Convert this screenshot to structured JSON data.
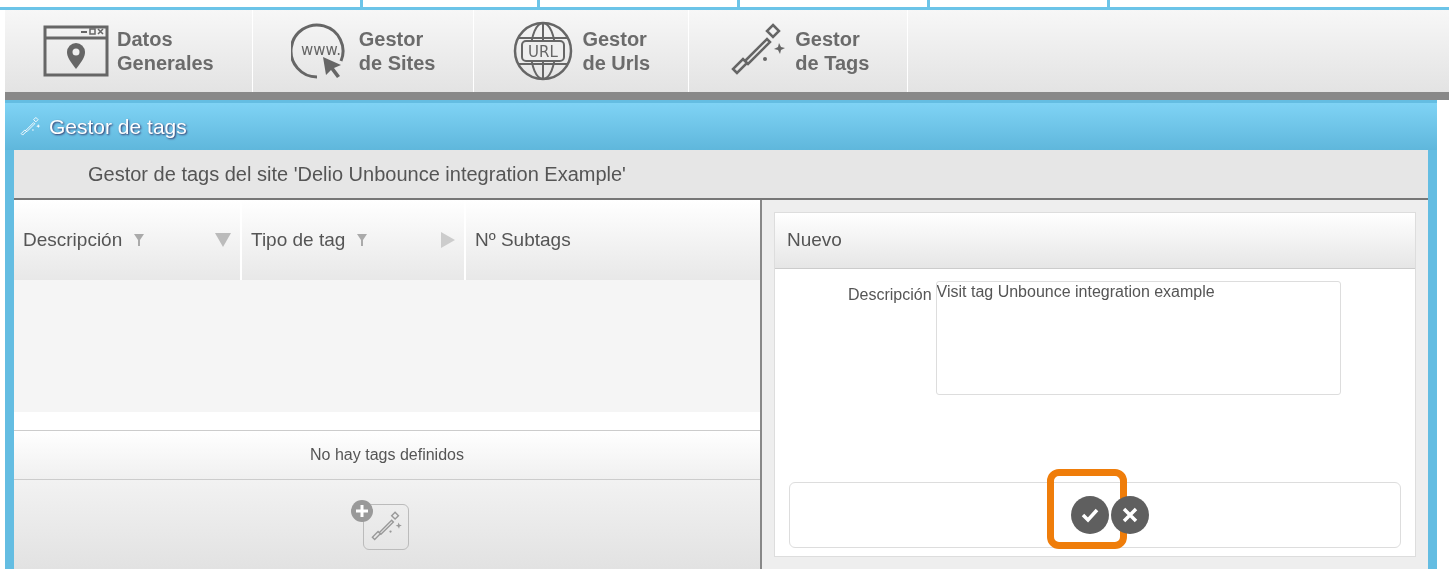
{
  "toolbar": [
    {
      "kind": "map",
      "line1": "Datos",
      "line2": "Generales",
      "selected": false
    },
    {
      "kind": "www",
      "icon_text": "www.",
      "line1": "Gestor",
      "line2": "de Sites",
      "selected": false
    },
    {
      "kind": "url",
      "icon_text": "URL",
      "line1": "Gestor",
      "line2": "de Urls",
      "selected": false
    },
    {
      "kind": "tags",
      "line1": "Gestor",
      "line2": "de Tags",
      "selected": false
    }
  ],
  "panel": {
    "title": "Gestor de tags",
    "subtitle": "Gestor de tags del site 'Delio Unbounce integration Example'"
  },
  "table": {
    "columns": [
      {
        "label": "Descripción",
        "filter": true,
        "sortable": true,
        "sorted": true
      },
      {
        "label": "Tipo de tag",
        "filter": true,
        "sortable": true,
        "sorted": false
      },
      {
        "label": "Nº Subtags",
        "filter": false,
        "sortable": false
      }
    ],
    "empty_message": "No hay tags definidos"
  },
  "form": {
    "title": "Nuevo",
    "field_label": "Descripción",
    "field_value": "Visit tag Unbounce integration example",
    "buttons": [
      {
        "kind": "confirm",
        "highlighted": true
      },
      {
        "kind": "cancel",
        "highlighted": false
      }
    ]
  }
}
